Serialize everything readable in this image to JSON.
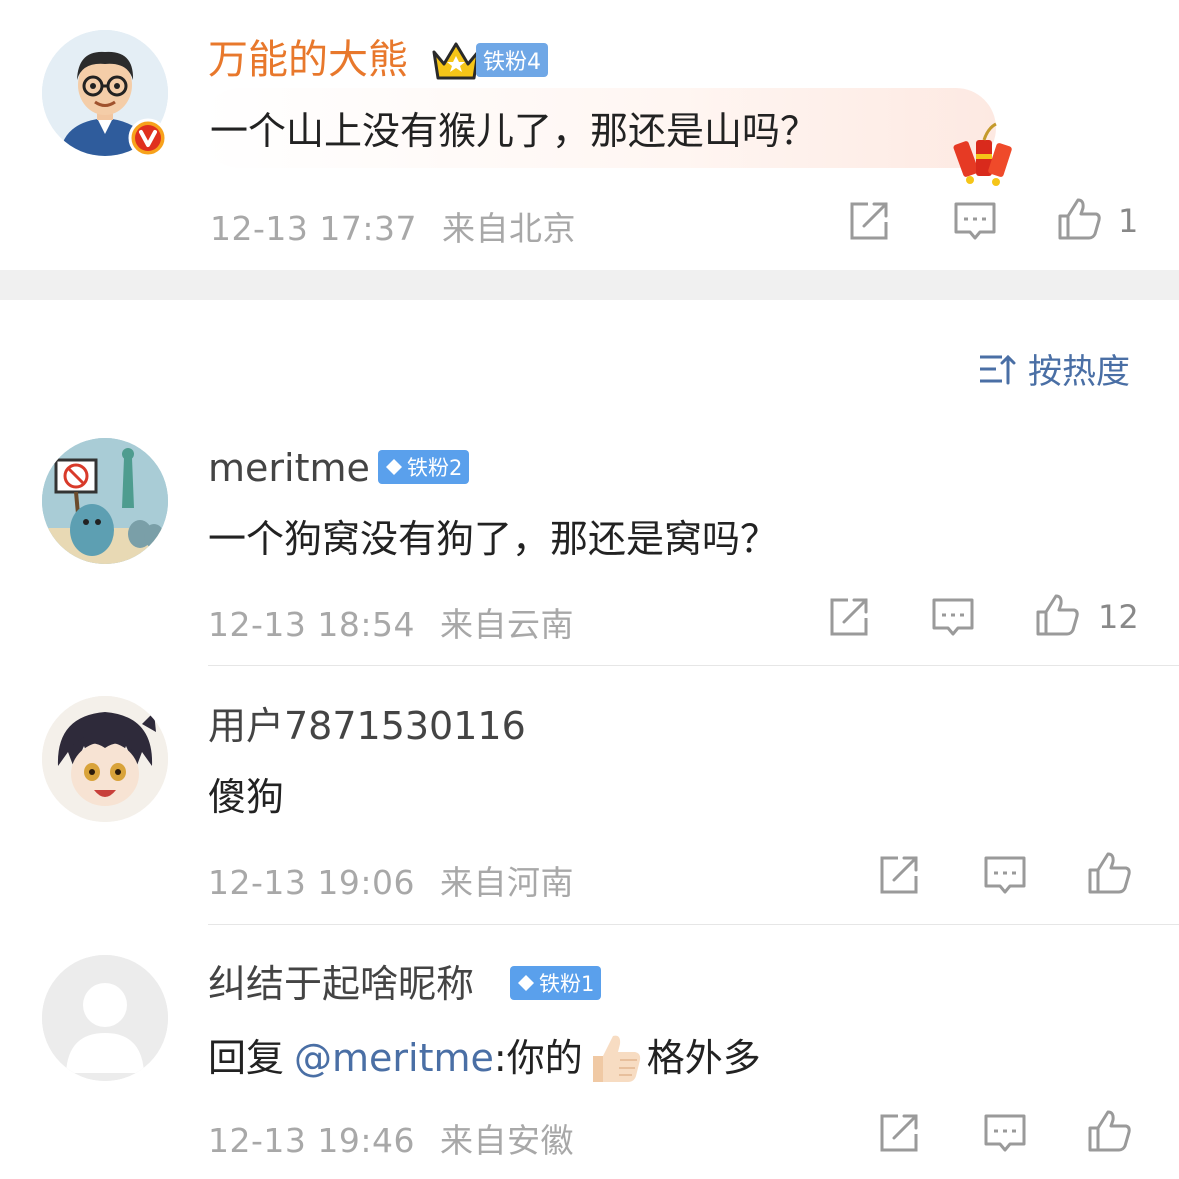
{
  "sort": {
    "label": "按热度"
  },
  "post": {
    "name": "万能的大熊",
    "badge": "铁粉4",
    "content": "一个山上没有猴儿了，那还是山吗？",
    "time": "12-13 17:37",
    "location": "来自北京",
    "likes": "1"
  },
  "comments": [
    {
      "name": "meritme",
      "badge": "铁粉2",
      "content": "一个狗窝没有狗了，那还是窝吗？",
      "time": "12-13 18:54",
      "location": "来自云南",
      "likes": "12"
    },
    {
      "name": "用户7871530116",
      "content": "傻狗",
      "time": "12-13 19:06",
      "location": "来自河南"
    },
    {
      "name": "纠结于起啥昵称",
      "badge": "铁粉1",
      "reply_prefix": "回复",
      "mention": "@meritme",
      "reply_sep": ":你的",
      "reply_suffix": "格外多",
      "time": "12-13 19:46",
      "location": "来自安徽"
    }
  ]
}
